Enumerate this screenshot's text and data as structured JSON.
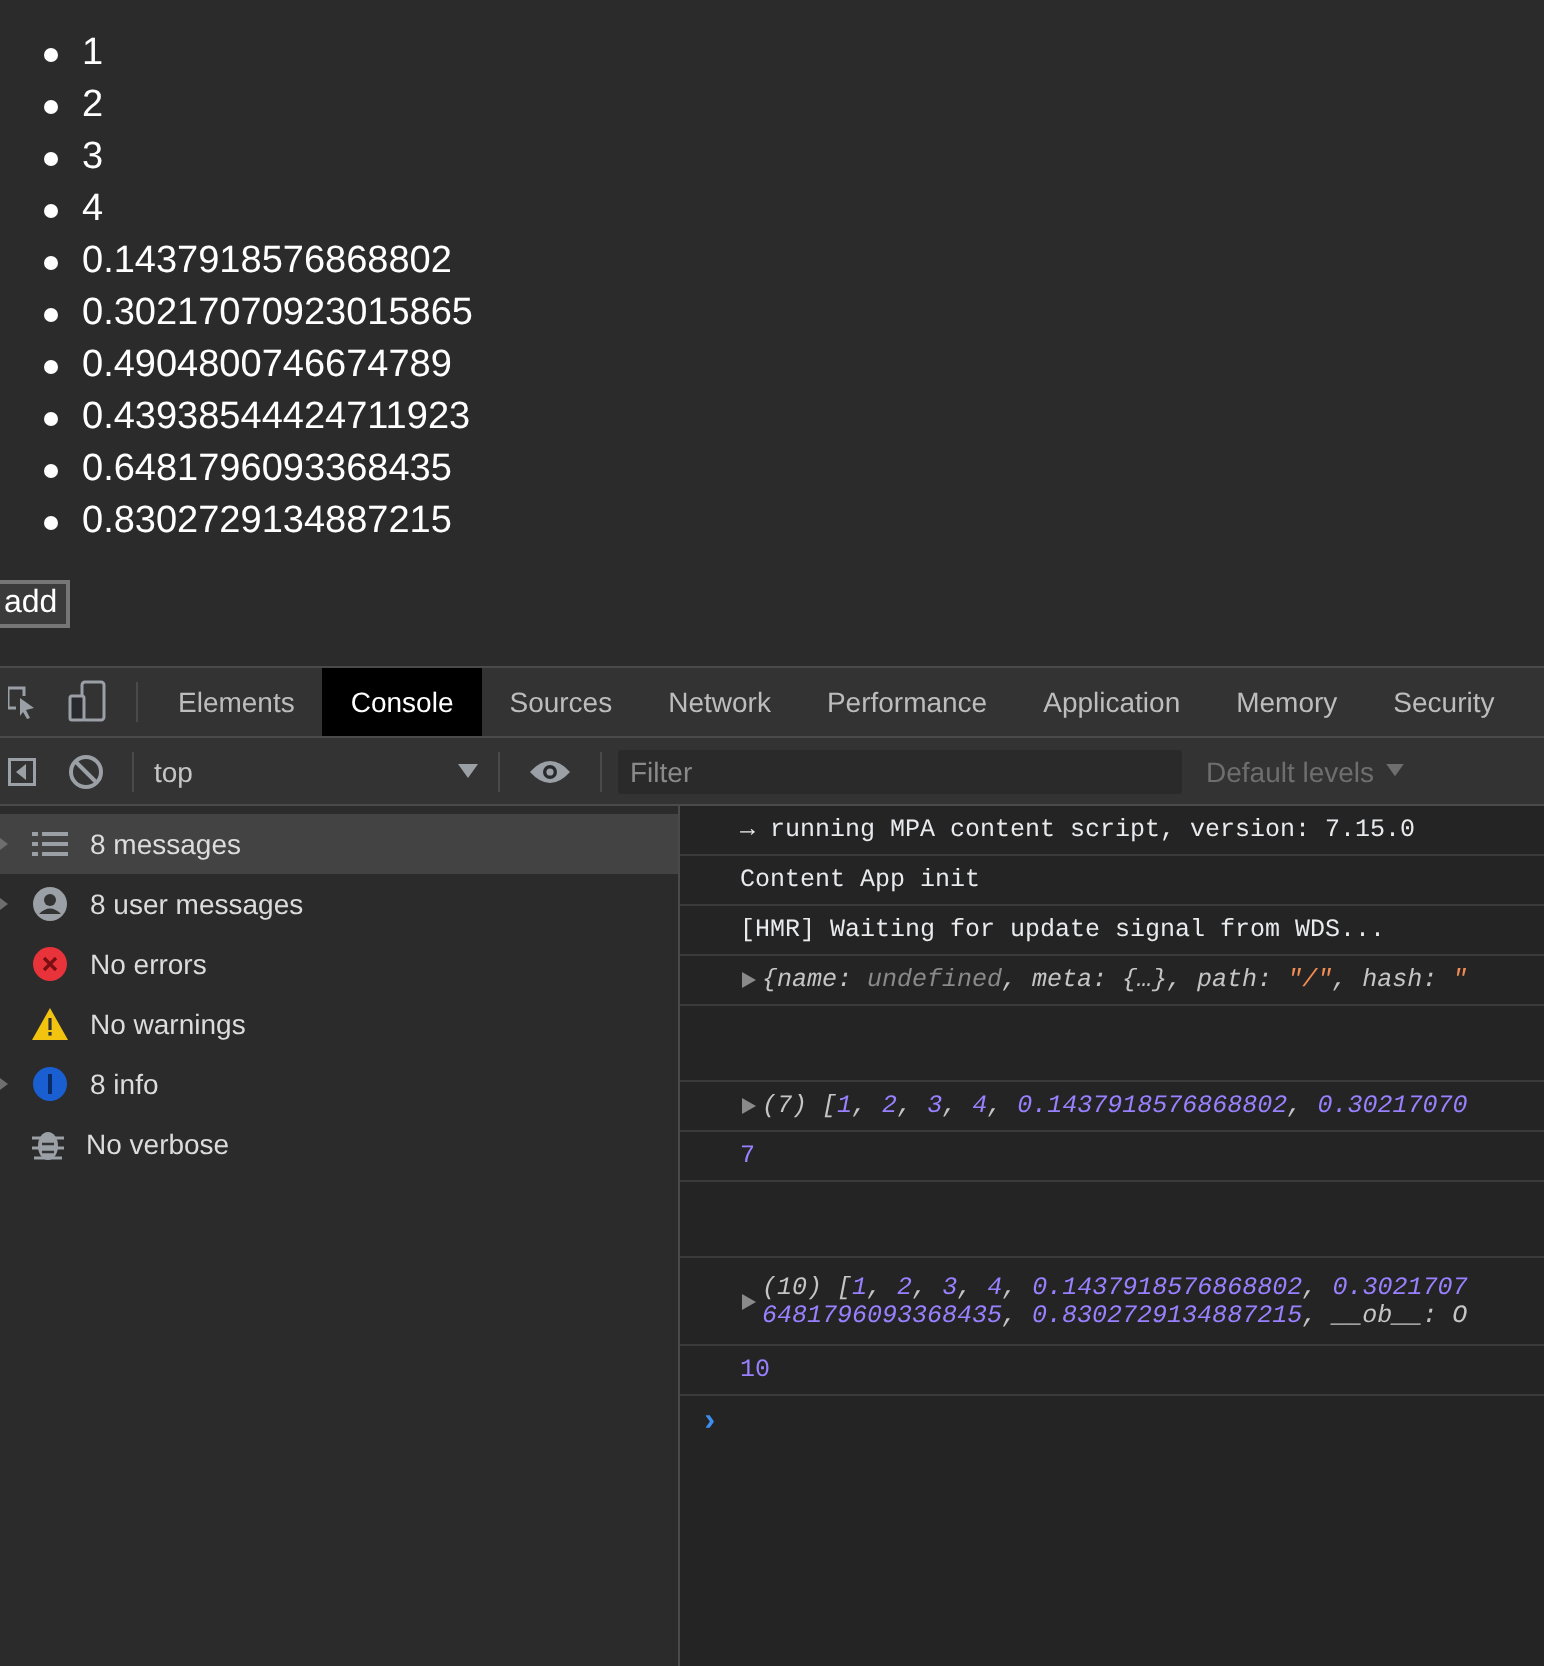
{
  "list": [
    "1",
    "2",
    "3",
    "4",
    "0.1437918576868802",
    "0.30217070923015865",
    "0.4904800746674789",
    "0.43938544424711923",
    "0.6481796093368435",
    "0.8302729134887215"
  ],
  "add_button": "add",
  "devtools": {
    "tabs": [
      {
        "label": "Elements",
        "selected": false
      },
      {
        "label": "Console",
        "selected": true
      },
      {
        "label": "Sources",
        "selected": false
      },
      {
        "label": "Network",
        "selected": false
      },
      {
        "label": "Performance",
        "selected": false
      },
      {
        "label": "Application",
        "selected": false
      },
      {
        "label": "Memory",
        "selected": false
      },
      {
        "label": "Security",
        "selected": false
      }
    ],
    "context": "top",
    "filter": {
      "placeholder": "Filter"
    },
    "levels": "Default levels",
    "sidebar": [
      {
        "kind": "list",
        "label": "8 messages",
        "expandable": true,
        "selected": true
      },
      {
        "kind": "user",
        "label": "8 user messages",
        "expandable": true,
        "selected": false
      },
      {
        "kind": "error",
        "label": "No errors",
        "expandable": false,
        "selected": false
      },
      {
        "kind": "warning",
        "label": "No warnings",
        "expandable": false,
        "selected": false
      },
      {
        "kind": "info",
        "label": "8 info",
        "expandable": true,
        "selected": false
      },
      {
        "kind": "verbose",
        "label": "No verbose",
        "expandable": false,
        "selected": false
      }
    ],
    "messages": [
      {
        "kind": "text",
        "parts": [
          {
            "kind": "plain",
            "text": "→ running MPA content script, version: 7.15.0"
          }
        ]
      },
      {
        "kind": "text",
        "parts": [
          {
            "kind": "plain",
            "text": "Content App init"
          }
        ]
      },
      {
        "kind": "text",
        "parts": [
          {
            "kind": "plain",
            "text": "[HMR] Waiting for update signal from WDS..."
          }
        ]
      },
      {
        "kind": "object",
        "parts": [
          {
            "kind": "key",
            "text": "{name: "
          },
          {
            "kind": "undef",
            "text": "undefined"
          },
          {
            "kind": "key",
            "text": ", meta: {…}, path: "
          },
          {
            "kind": "string",
            "text": "\"/\""
          },
          {
            "kind": "key",
            "text": ", hash: "
          },
          {
            "kind": "string",
            "text": "\""
          }
        ]
      },
      {
        "kind": "spacer"
      },
      {
        "kind": "object",
        "parts": [
          {
            "kind": "key",
            "text": "(7) ["
          },
          {
            "kind": "number",
            "text": "1"
          },
          {
            "kind": "key",
            "text": ", "
          },
          {
            "kind": "number",
            "text": "2"
          },
          {
            "kind": "key",
            "text": ", "
          },
          {
            "kind": "number",
            "text": "3"
          },
          {
            "kind": "key",
            "text": ", "
          },
          {
            "kind": "number",
            "text": "4"
          },
          {
            "kind": "key",
            "text": ", "
          },
          {
            "kind": "number",
            "text": "0.1437918576868802"
          },
          {
            "kind": "key",
            "text": ", "
          },
          {
            "kind": "number",
            "text": "0.30217070"
          }
        ]
      },
      {
        "kind": "value",
        "parts": [
          {
            "kind": "number",
            "text": "7"
          }
        ]
      },
      {
        "kind": "spacer"
      },
      {
        "kind": "object",
        "parts": [
          {
            "kind": "key",
            "text": "(10) ["
          },
          {
            "kind": "number",
            "text": "1"
          },
          {
            "kind": "key",
            "text": ", "
          },
          {
            "kind": "number",
            "text": "2"
          },
          {
            "kind": "key",
            "text": ", "
          },
          {
            "kind": "number",
            "text": "3"
          },
          {
            "kind": "key",
            "text": ", "
          },
          {
            "kind": "number",
            "text": "4"
          },
          {
            "kind": "key",
            "text": ", "
          },
          {
            "kind": "number",
            "text": "0.1437918576868802"
          },
          {
            "kind": "key",
            "text": ", "
          },
          {
            "kind": "number",
            "text": "0.3021707"
          }
        ],
        "wrap": [
          {
            "kind": "number",
            "text": "6481796093368435"
          },
          {
            "kind": "key",
            "text": ", "
          },
          {
            "kind": "number",
            "text": "0.8302729134887215"
          },
          {
            "kind": "key",
            "text": ", __ob__: O"
          }
        ]
      },
      {
        "kind": "value",
        "parts": [
          {
            "kind": "number",
            "text": "10"
          }
        ]
      }
    ],
    "prompt": "›"
  }
}
